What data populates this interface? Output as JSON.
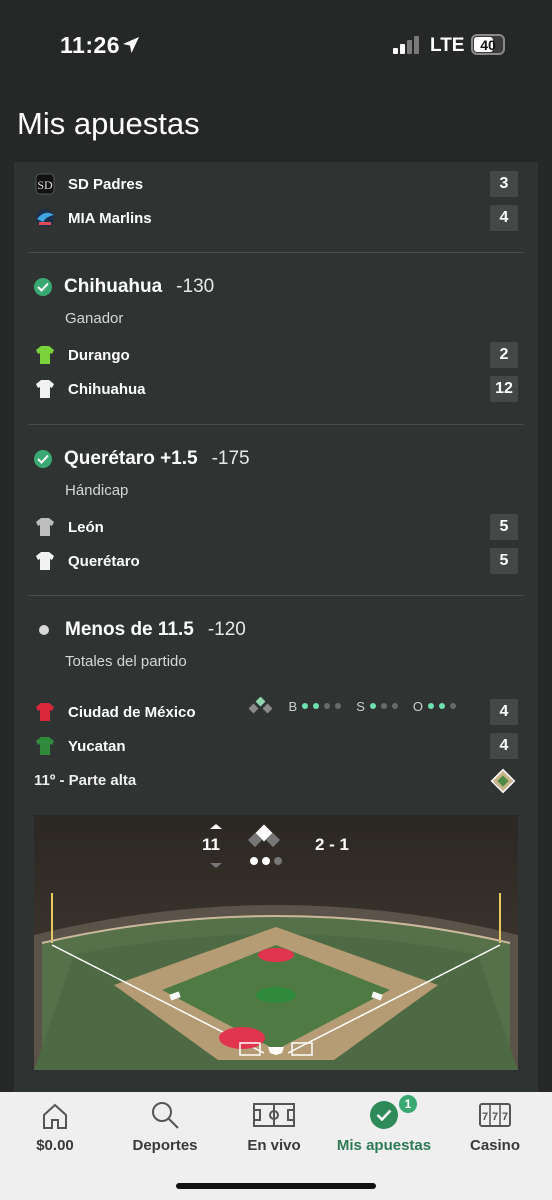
{
  "status": {
    "time": "11:26",
    "network": "LTE",
    "battery": "40"
  },
  "page_title": "Mis apuestas",
  "game1": {
    "teams": [
      {
        "name": "SD Padres",
        "score": "3"
      },
      {
        "name": "MIA Marlins",
        "score": "4"
      }
    ]
  },
  "bet1": {
    "selection": "Chihuahua",
    "odds": "-130",
    "market": "Ganador",
    "teams": [
      {
        "name": "Durango",
        "score": "2",
        "color": "#7bd33c"
      },
      {
        "name": "Chihuahua",
        "score": "12",
        "color": "#f2f2f2"
      }
    ]
  },
  "bet2": {
    "selection": "Querétaro +1.5",
    "odds": "-175",
    "market": "Hándicap",
    "teams": [
      {
        "name": "León",
        "score": "5",
        "color": "#bdbdbd"
      },
      {
        "name": "Querétaro",
        "score": "5",
        "color": "#f2f2f2"
      }
    ]
  },
  "bet3": {
    "selection": "Menos de 11.5",
    "odds": "-120",
    "market": "Totales del partido",
    "teams": [
      {
        "name": "Ciudad de México",
        "score": "4",
        "color": "#d8283a"
      },
      {
        "name": "Yucatan",
        "score": "4",
        "color": "#2f8a3c"
      }
    ],
    "count_labels": {
      "balls": "B",
      "strikes": "S",
      "outs": "O"
    },
    "inning_label": "11º - Parte alta",
    "field": {
      "inning": "11",
      "count": "2 - 1"
    }
  },
  "colors": {
    "accent": "#3aa872",
    "panel": "#2f3332",
    "background": "#262827"
  },
  "nav": {
    "tabs": [
      {
        "label": "$0.00",
        "icon": "home-icon"
      },
      {
        "label": "Deportes",
        "icon": "search-icon"
      },
      {
        "label": "En vivo",
        "icon": "field-icon"
      },
      {
        "label": "Mis apuestas",
        "icon": "check-icon",
        "badge": "1",
        "active": true
      },
      {
        "label": "Casino",
        "icon": "slots-icon"
      }
    ]
  }
}
